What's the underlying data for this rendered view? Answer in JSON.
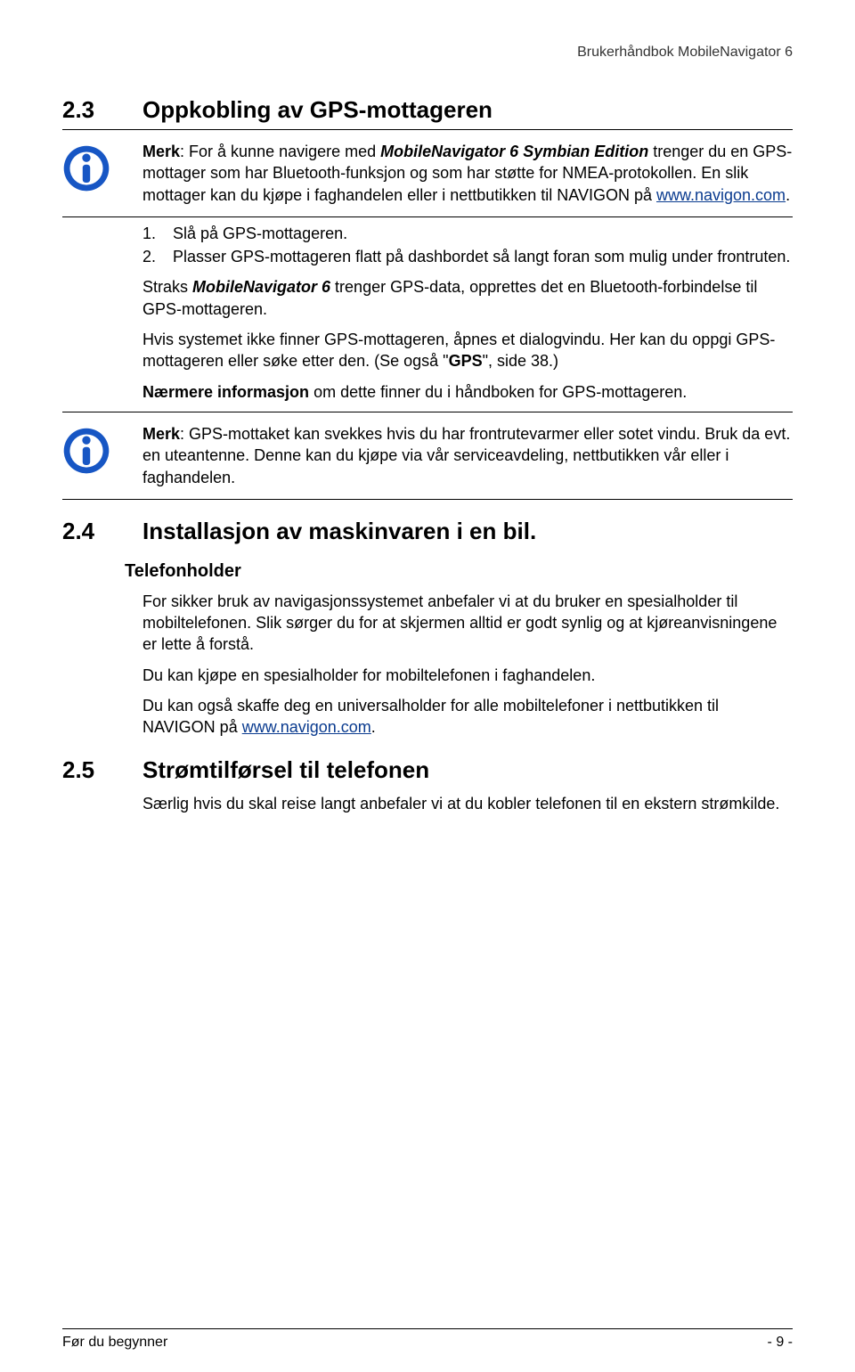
{
  "header": "Brukerhåndbok MobileNavigator 6",
  "s23": {
    "num": "2.3",
    "title": "Oppkobling av GPS-mottageren",
    "note1_label": "Merk",
    "note1_text": ": For å kunne navigere med ",
    "note1_product": "MobileNavigator 6 Symbian Edition",
    "note1_cont": " trenger du en GPS-mottager som har Bluetooth-funksjon og som har støtte for NMEA-protokollen. En slik mottager kan du kjøpe i faghandelen eller i nettbutikken til NAVIGON på ",
    "note1_link": "www.navigon.com",
    "note1_end": ".",
    "step1": "Slå på GPS-mottageren.",
    "step2": "Plasser GPS-mottageren flatt på dashbordet så langt foran som mulig under frontruten.",
    "p_straks_a": "Straks ",
    "p_straks_prod": "MobileNavigator 6",
    "p_straks_b": " trenger GPS-data, opprettes det en Bluetooth-forbindelse til GPS-mottageren.",
    "p_hvis_a": "Hvis systemet ikke finner GPS-mottageren, åpnes et dialogvindu. Her kan du oppgi GPS-mottageren eller søke etter den. (Se også \"",
    "p_hvis_gps": "GPS",
    "p_hvis_b": "\", side 38.)",
    "p_naer_label": "Nærmere informasjon",
    "p_naer_text": " om dette finner du i håndboken for GPS-mottageren.",
    "note2_label": "Merk",
    "note2_text": ": GPS-mottaket kan svekkes hvis du har frontrutevarmer eller sotet vindu. Bruk da evt. en uteantenne. Denne kan du kjøpe via vår serviceavdeling, nettbutikken vår eller i faghandelen."
  },
  "s24": {
    "num": "2.4",
    "title": "Installasjon av maskinvaren i en bil.",
    "sub": "Telefonholder",
    "p1": "For sikker bruk av navigasjonssystemet anbefaler vi at du bruker en spesialholder til mobiltelefonen. Slik sørger du for at skjermen alltid er godt synlig og at kjøreanvisningene er lette å forstå.",
    "p2": "Du kan kjøpe en spesialholder for mobiltelefonen i faghandelen.",
    "p3a": "Du kan også skaffe deg en universalholder for alle mobiltelefoner i nettbutikken til NAVIGON på ",
    "p3link": "www.navigon.com",
    "p3b": "."
  },
  "s25": {
    "num": "2.5",
    "title": "Strømtilførsel til telefonen",
    "p1": "Særlig hvis du skal reise langt anbefaler vi at du kobler telefonen til en ekstern strømkilde."
  },
  "footer": {
    "left": "Før du begynner",
    "right": "- 9 -"
  }
}
